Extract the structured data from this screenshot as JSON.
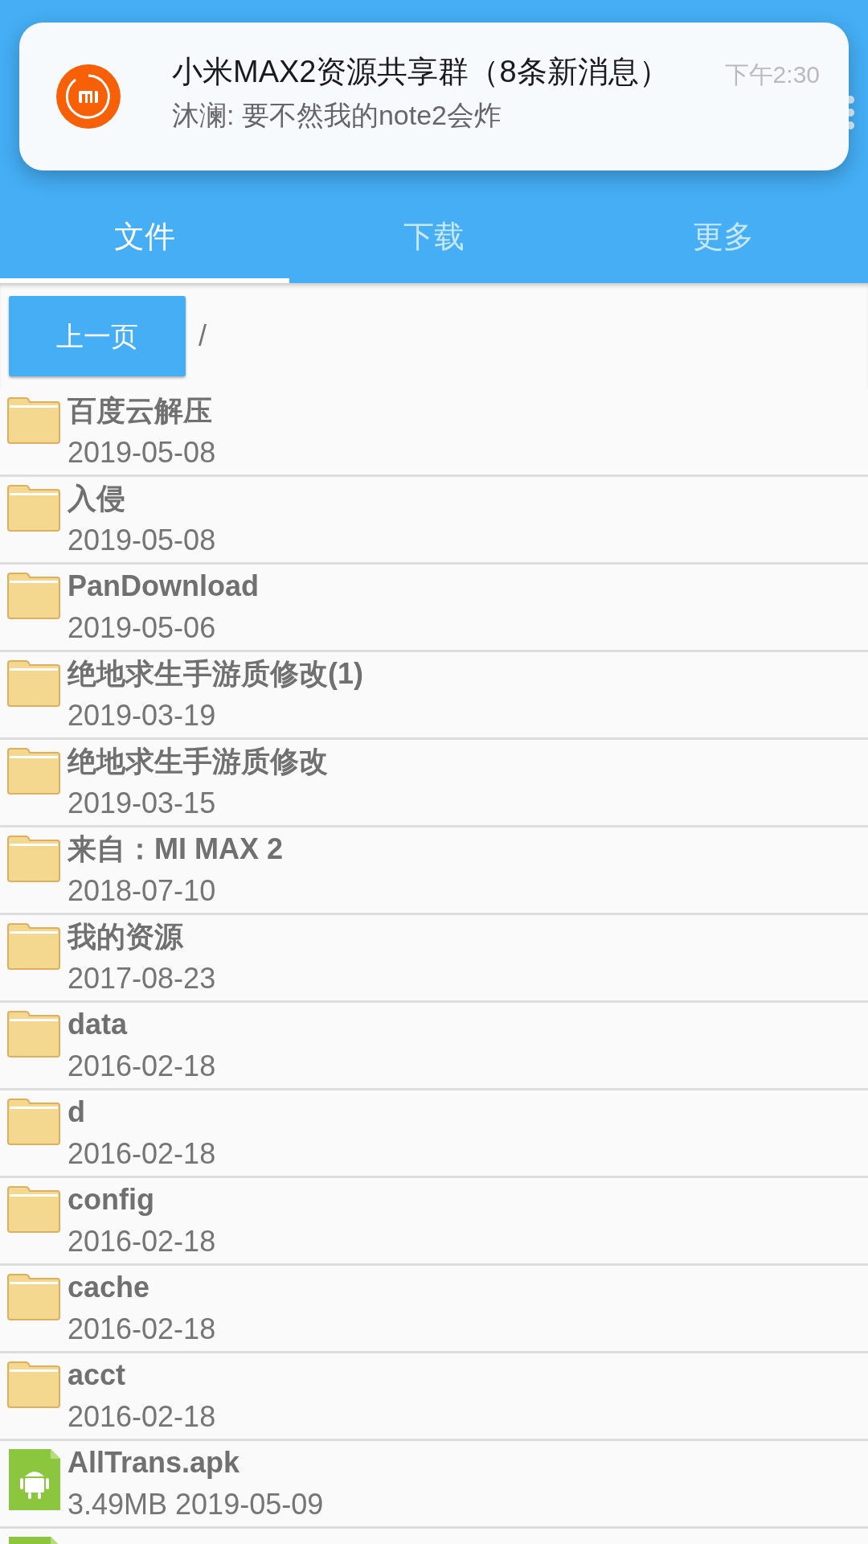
{
  "notification": {
    "title": "小米MAX2资源共享群（8条新消息）",
    "message": "沐澜: 要不然我的note2会炸",
    "time": "下午2:30"
  },
  "tabs": [
    {
      "label": "文件",
      "selected": true
    },
    {
      "label": "下载",
      "selected": false
    },
    {
      "label": "更多",
      "selected": false
    }
  ],
  "toolbar": {
    "back_button": "上一页",
    "path": "/"
  },
  "files": [
    {
      "kind": "folder",
      "name": "百度云解压",
      "detail": "2019-05-08"
    },
    {
      "kind": "folder",
      "name": "入侵",
      "detail": "2019-05-08"
    },
    {
      "kind": "folder",
      "name": "PanDownload",
      "detail": "2019-05-06"
    },
    {
      "kind": "folder",
      "name": "绝地求生手游质修改(1)",
      "detail": "2019-03-19"
    },
    {
      "kind": "folder",
      "name": "绝地求生手游质修改",
      "detail": "2019-03-15"
    },
    {
      "kind": "folder",
      "name": "来自：MI MAX 2",
      "detail": "2018-07-10"
    },
    {
      "kind": "folder",
      "name": "我的资源",
      "detail": "2017-08-23"
    },
    {
      "kind": "folder",
      "name": "data",
      "detail": "2016-02-18"
    },
    {
      "kind": "folder",
      "name": "d",
      "detail": "2016-02-18"
    },
    {
      "kind": "folder",
      "name": "config",
      "detail": "2016-02-18"
    },
    {
      "kind": "folder",
      "name": "cache",
      "detail": "2016-02-18"
    },
    {
      "kind": "folder",
      "name": "acct",
      "detail": "2016-02-18"
    },
    {
      "kind": "apk",
      "name": "AllTrans.apk",
      "detail": "3.49MB 2019-05-09"
    },
    {
      "kind": "apk"
    }
  ]
}
